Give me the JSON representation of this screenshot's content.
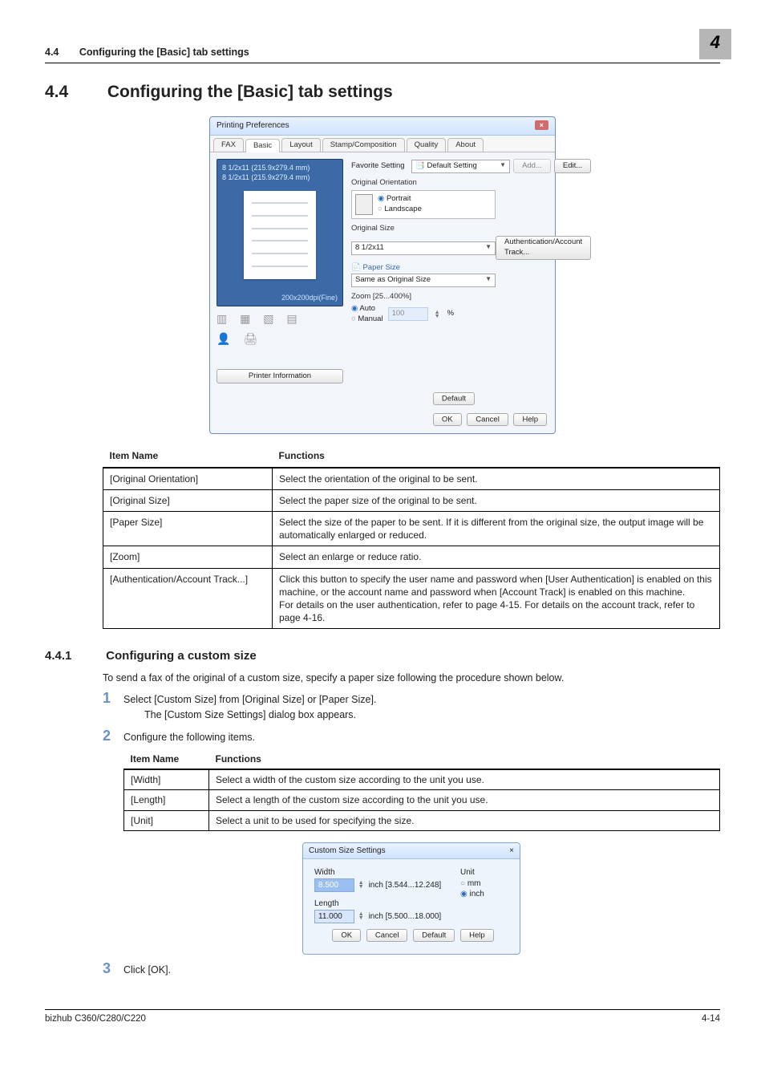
{
  "header": {
    "section_number": "4.4",
    "section_title": "Configuring the [Basic] tab settings",
    "chapter_number": "4"
  },
  "heading": {
    "number": "4.4",
    "title": "Configuring the [Basic] tab settings"
  },
  "sub_heading": {
    "number": "4.4.1",
    "title": "Configuring a custom size",
    "intro": "To send a fax of the original of a custom size, specify a paper size following the procedure shown below."
  },
  "dialog1": {
    "title": "Printing Preferences",
    "tabs": [
      "FAX",
      "Basic",
      "Layout",
      "Stamp/Composition",
      "Quality",
      "About"
    ],
    "active_tab": "Basic",
    "preview_line1": "8 1/2x11 (215.9x279.4 mm)",
    "preview_line2": "8 1/2x11 (215.9x279.4 mm)",
    "preview_dpi": "200x200dpi(Fine)",
    "printer_info_btn": "Printer Information",
    "favorite_label": "Favorite Setting",
    "favorite_value": "Default Setting",
    "add_btn": "Add...",
    "edit_btn": "Edit...",
    "orientation_label": "Original Orientation",
    "portrait": "Portrait",
    "landscape": "Landscape",
    "original_size_label": "Original Size",
    "original_size_value": "8 1/2x11",
    "paper_size_label": "Paper Size",
    "paper_size_value": "Same as Original Size",
    "zoom_label": "Zoom [25...400%]",
    "zoom_auto": "Auto",
    "zoom_manual": "Manual",
    "zoom_value": "100",
    "zoom_pct": "%",
    "auth_btn": "Authentication/Account Track...",
    "default_btn": "Default",
    "ok_btn": "OK",
    "cancel_btn": "Cancel",
    "help_btn": "Help"
  },
  "table1": {
    "head_item": "Item Name",
    "head_func": "Functions",
    "r1_item": "[Original Orientation]",
    "r1_func": "Select the orientation of the original to be sent.",
    "r2_item": "[Original Size]",
    "r2_func": "Select the paper size of the original to be sent.",
    "r3_item": "[Paper Size]",
    "r3_func": "Select the size of the paper to be sent. If it is different from the original size, the output image will be automatically enlarged or reduced.",
    "r4_item": "[Zoom]",
    "r4_func": "Select an enlarge or reduce ratio.",
    "r5_item": "[Authentication/Account Track...]",
    "r5_func": "Click this button to specify the user name and password when [User Authentication] is enabled on this machine, or the account name and password when [Account Track] is enabled on this machine.\nFor details on the user authentication, refer to page 4-15. For details on the account track, refer to page 4-16."
  },
  "steps": {
    "s1": "Select [Custom Size] from [Original Size] or [Paper Size].",
    "s1_sub": "The [Custom Size Settings] dialog box appears.",
    "s2": "Configure the following items.",
    "s3": "Click [OK]."
  },
  "table2": {
    "head_item": "Item Name",
    "head_func": "Functions",
    "r1_item": "[Width]",
    "r1_func": "Select a width of the custom size according to the unit you use.",
    "r2_item": "[Length]",
    "r2_func": "Select a length of the custom size according to the unit you use.",
    "r3_item": "[Unit]",
    "r3_func": "Select a unit to be used for specifying the size."
  },
  "dialog2": {
    "title": "Custom Size Settings",
    "width_label": "Width",
    "width_value": "8.500",
    "width_range": "inch [3.544...12.248]",
    "length_label": "Length",
    "length_value": "11.000",
    "length_range": "inch [5.500...18.000]",
    "unit_label": "Unit",
    "mm": "mm",
    "inch": "inch",
    "ok_btn": "OK",
    "cancel_btn": "Cancel",
    "default_btn": "Default",
    "help_btn": "Help"
  },
  "footer": {
    "model": "bizhub C360/C280/C220",
    "page": "4-14"
  }
}
